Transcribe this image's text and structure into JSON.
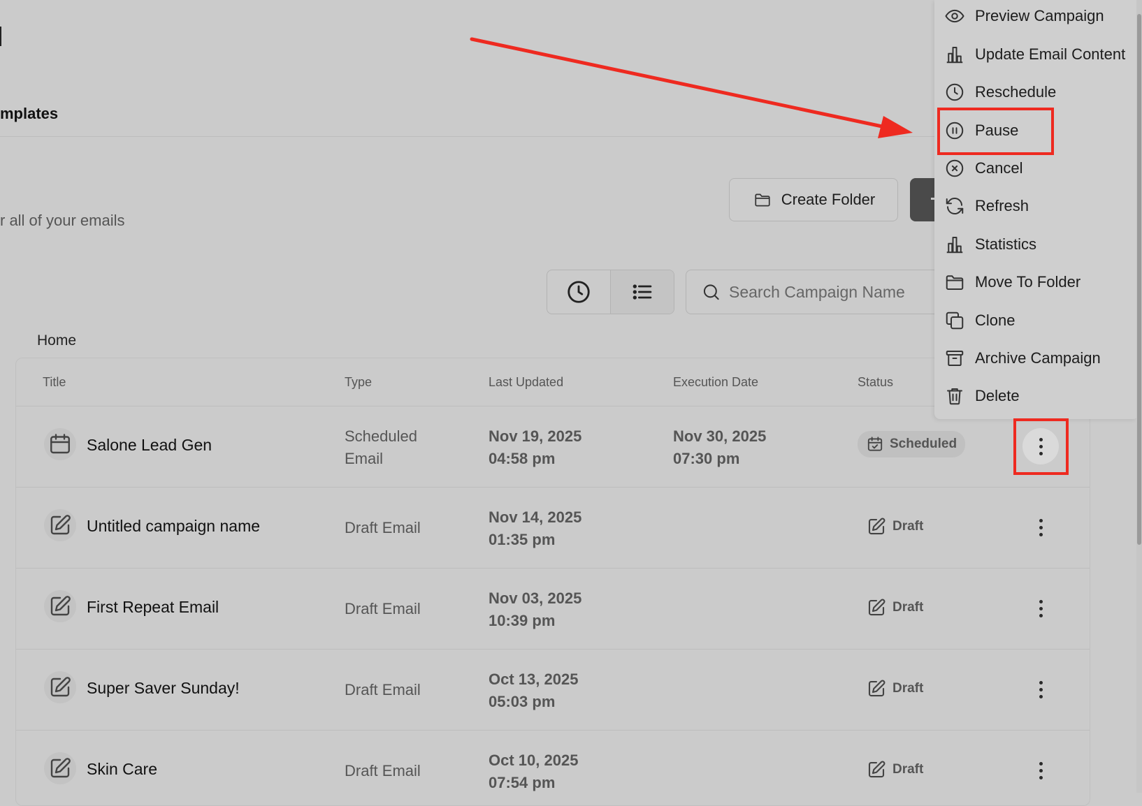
{
  "header": {
    "tab_label": "mplates",
    "subtitle": "r all of your emails"
  },
  "toolbar": {
    "create_folder_label": "Create Folder",
    "search_placeholder": "Search Campaign Name"
  },
  "breadcrumb": "Home",
  "table": {
    "columns": [
      "Title",
      "Type",
      "Last Updated",
      "Execution Date",
      "Status"
    ],
    "rows": [
      {
        "title": "Salone Lead Gen",
        "type_line1": "Scheduled",
        "type_line2": "Email",
        "updated_date": "Nov 19, 2025",
        "updated_time": "04:58 pm",
        "exec_date": "Nov 30, 2025",
        "exec_time": "07:30 pm",
        "status": "Scheduled",
        "icon": "calendar-icon"
      },
      {
        "title": "Untitled campaign name",
        "type": "Draft Email",
        "updated_date": "Nov 14, 2025",
        "updated_time": "01:35 pm",
        "status": "Draft",
        "icon": "edit-icon"
      },
      {
        "title": "First Repeat Email",
        "type": "Draft Email",
        "updated_date": "Nov 03, 2025",
        "updated_time": "10:39 pm",
        "status": "Draft",
        "icon": "edit-icon"
      },
      {
        "title": "Super Saver Sunday!",
        "type": "Draft Email",
        "updated_date": "Oct 13, 2025",
        "updated_time": "05:03 pm",
        "status": "Draft",
        "icon": "edit-icon"
      },
      {
        "title": "Skin Care",
        "type": "Draft Email",
        "updated_date": "Oct 10, 2025",
        "updated_time": "07:54 pm",
        "status": "Draft",
        "icon": "edit-icon"
      }
    ]
  },
  "context_menu": {
    "items": [
      {
        "label": "Preview Campaign",
        "icon": "eye-icon"
      },
      {
        "label": "Update Email Content",
        "icon": "bar-chart-icon"
      },
      {
        "label": "Reschedule",
        "icon": "clock-icon"
      },
      {
        "label": "Pause",
        "icon": "pause-icon"
      },
      {
        "label": "Cancel",
        "icon": "x-circle-icon"
      },
      {
        "label": "Refresh",
        "icon": "refresh-icon"
      },
      {
        "label": "Statistics",
        "icon": "bar-chart-icon"
      },
      {
        "label": "Move To Folder",
        "icon": "folder-icon"
      },
      {
        "label": "Clone",
        "icon": "copy-icon"
      },
      {
        "label": "Archive Campaign",
        "icon": "archive-icon"
      },
      {
        "label": "Delete",
        "icon": "trash-icon"
      }
    ]
  },
  "colors": {
    "background": "#cbcbcb",
    "annotation": "#ee2a20",
    "primary_button": "#4a4a4a"
  }
}
